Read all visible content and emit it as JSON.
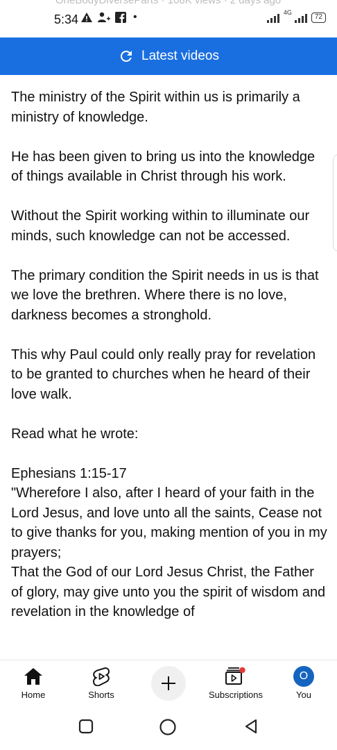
{
  "status_bar": {
    "ghost_text": "OneBodyDiverseParts · 108K views · 2 days ago",
    "time": "5:34",
    "network": "4G",
    "battery": "72"
  },
  "banner": {
    "label": "Latest videos"
  },
  "article": {
    "paragraphs": [
      "The ministry of the Spirit within us is primarily a ministry of knowledge.",
      "He has been given to bring us into the knowledge of things available in Christ through his work.",
      "Without the Spirit working within to illuminate our minds, such knowledge can not be accessed.",
      "The primary condition the Spirit needs in us is that we love the brethren. Where there is no love, darkness becomes a stronghold.",
      "This why Paul could only really pray for revelation to be granted to churches when he heard of their love walk.",
      "Read what he wrote:"
    ],
    "reference": "Ephesians 1:15-17",
    "quote_1": "\"Wherefore I also, after I heard of your faith in the Lord Jesus, and love unto all the saints, Cease not to give thanks for you, making mention of you in my prayers;",
    "quote_2": "That the God of our Lord Jesus Christ, the Father of glory, may give unto you the spirit of wisdom and revelation in the knowledge of"
  },
  "bottom_nav": {
    "home": "Home",
    "shorts": "Shorts",
    "subscriptions": "Subscriptions",
    "you": "You",
    "avatar_letter": "O"
  },
  "colors": {
    "banner": "#1a6fe0",
    "avatar": "#1565c0",
    "notification_dot": "#e53935"
  }
}
